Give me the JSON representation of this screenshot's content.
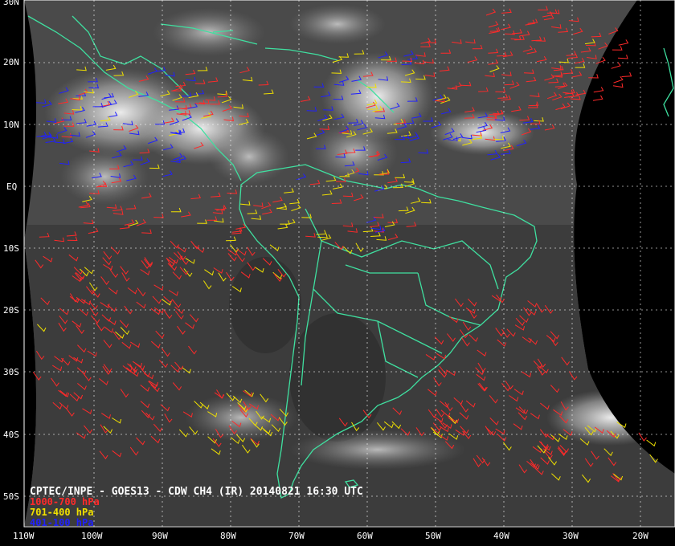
{
  "map": {
    "title": "CPTEC/INPE - GOES13 - CDW CH4 (IR) 20140821 16:30 UTC",
    "latitude_labels": [
      "30N",
      "20N",
      "10N",
      "EQ",
      "10S",
      "20S",
      "30S",
      "40S",
      "50S"
    ],
    "longitude_labels": [
      "110W",
      "100W",
      "90W",
      "80W",
      "70W",
      "60W",
      "50W",
      "40W",
      "30W",
      "20W"
    ],
    "legend": [
      {
        "label": "1000-700 hPa",
        "color": "#ff2a2a"
      },
      {
        "label": "701-400 hPa",
        "color": "#f0e000"
      },
      {
        "label": "401-100 hPa",
        "color": "#2020ff"
      }
    ],
    "colors": {
      "background": "#000000",
      "coastline": "#3fe0a0",
      "grid": "#ffffff",
      "frame": "#ffffff"
    }
  }
}
